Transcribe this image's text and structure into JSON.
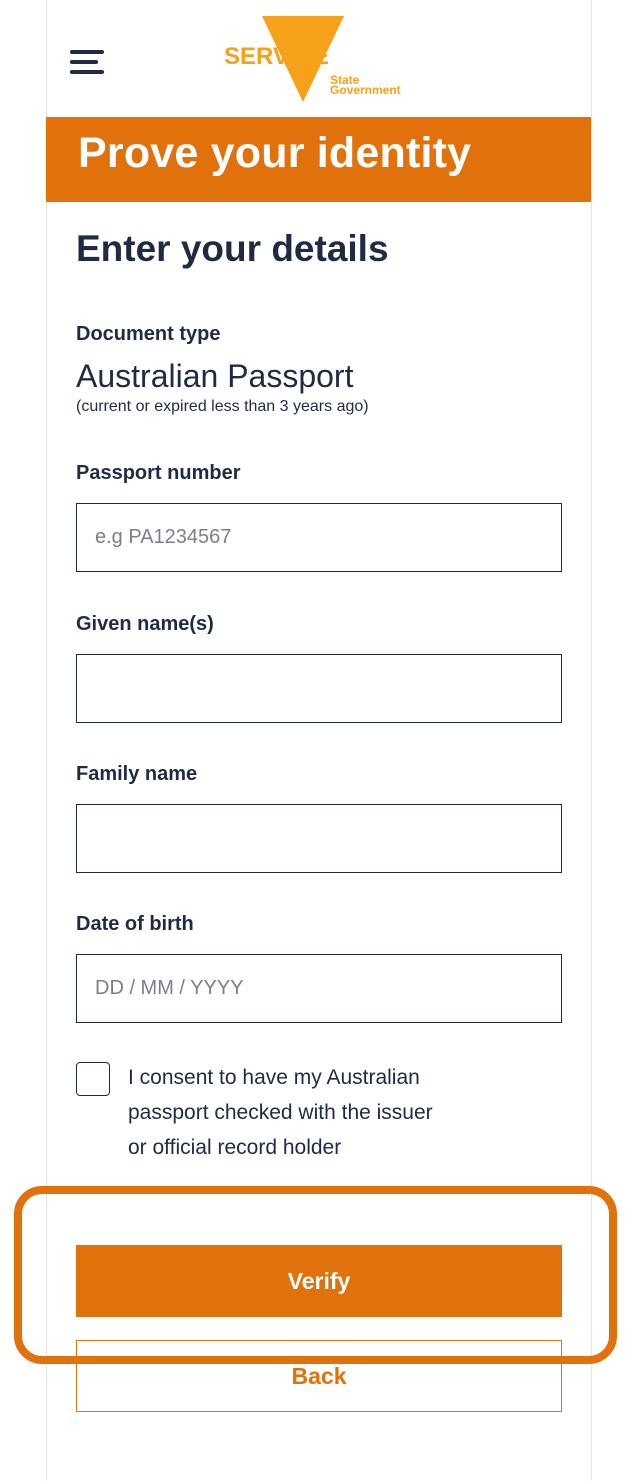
{
  "header": {
    "logo": {
      "brand": "SERVICE",
      "sub_line1": "State",
      "sub_line2": "Government"
    }
  },
  "banner": {
    "title": "Prove your identity"
  },
  "form": {
    "heading": "Enter your details",
    "document_type": {
      "label": "Document type",
      "value": "Australian Passport",
      "note": "(current or expired less than 3 years ago)"
    },
    "passport_number": {
      "label": "Passport number",
      "value": "",
      "placeholder": "e.g PA1234567"
    },
    "given_names": {
      "label": "Given name(s)",
      "value": "",
      "placeholder": ""
    },
    "family_name": {
      "label": "Family name",
      "value": "",
      "placeholder": ""
    },
    "date_of_birth": {
      "label": "Date of birth",
      "value": "",
      "placeholder": "DD / MM / YYYY"
    },
    "consent": {
      "line1": "I consent to have my Australian",
      "line2": "passport checked with the issuer",
      "line3": "or official record holder",
      "checked": false
    }
  },
  "buttons": {
    "verify": "Verify",
    "back": "Back"
  },
  "colors": {
    "brand_orange": "#e0710b",
    "text_navy": "#1f2a44",
    "white": "#ffffff"
  },
  "icons": {
    "menu": "hamburger-menu-icon",
    "logo": "triangle-logo"
  }
}
